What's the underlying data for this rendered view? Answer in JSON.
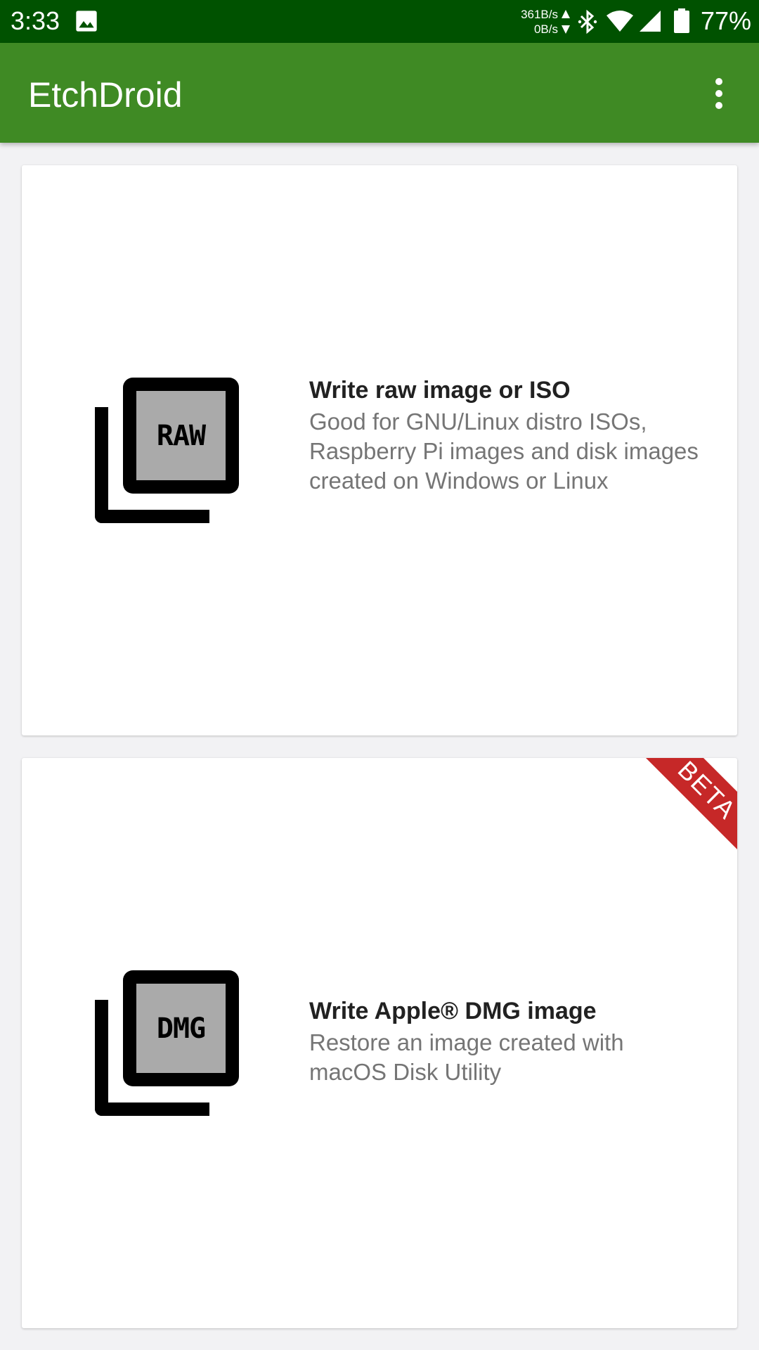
{
  "status_bar": {
    "time": "3:33",
    "net_up": "361B/s",
    "net_down": "0B/s",
    "battery": "77%",
    "icons": [
      "image-icon",
      "net-arrows-icon",
      "bluetooth-icon",
      "wifi-icon",
      "signal-icon",
      "battery-icon"
    ]
  },
  "app_bar": {
    "title": "EtchDroid",
    "menu_icon": "overflow-menu-icon"
  },
  "cards": {
    "raw": {
      "icon_label": "RAW",
      "title": "Write raw image or ISO",
      "description": "Good for GNU/Linux distro ISOs, Raspberry Pi images and disk images created on Windows or Linux"
    },
    "dmg": {
      "icon_label": "DMG",
      "badge": "BETA",
      "title": "Write Apple® DMG image",
      "description": "Restore an image created with macOS Disk Utility"
    }
  },
  "colors": {
    "status_bar": "#005200",
    "app_bar": "#3f8a24",
    "beta_ribbon": "#c62828",
    "background": "#f2f2f4"
  }
}
